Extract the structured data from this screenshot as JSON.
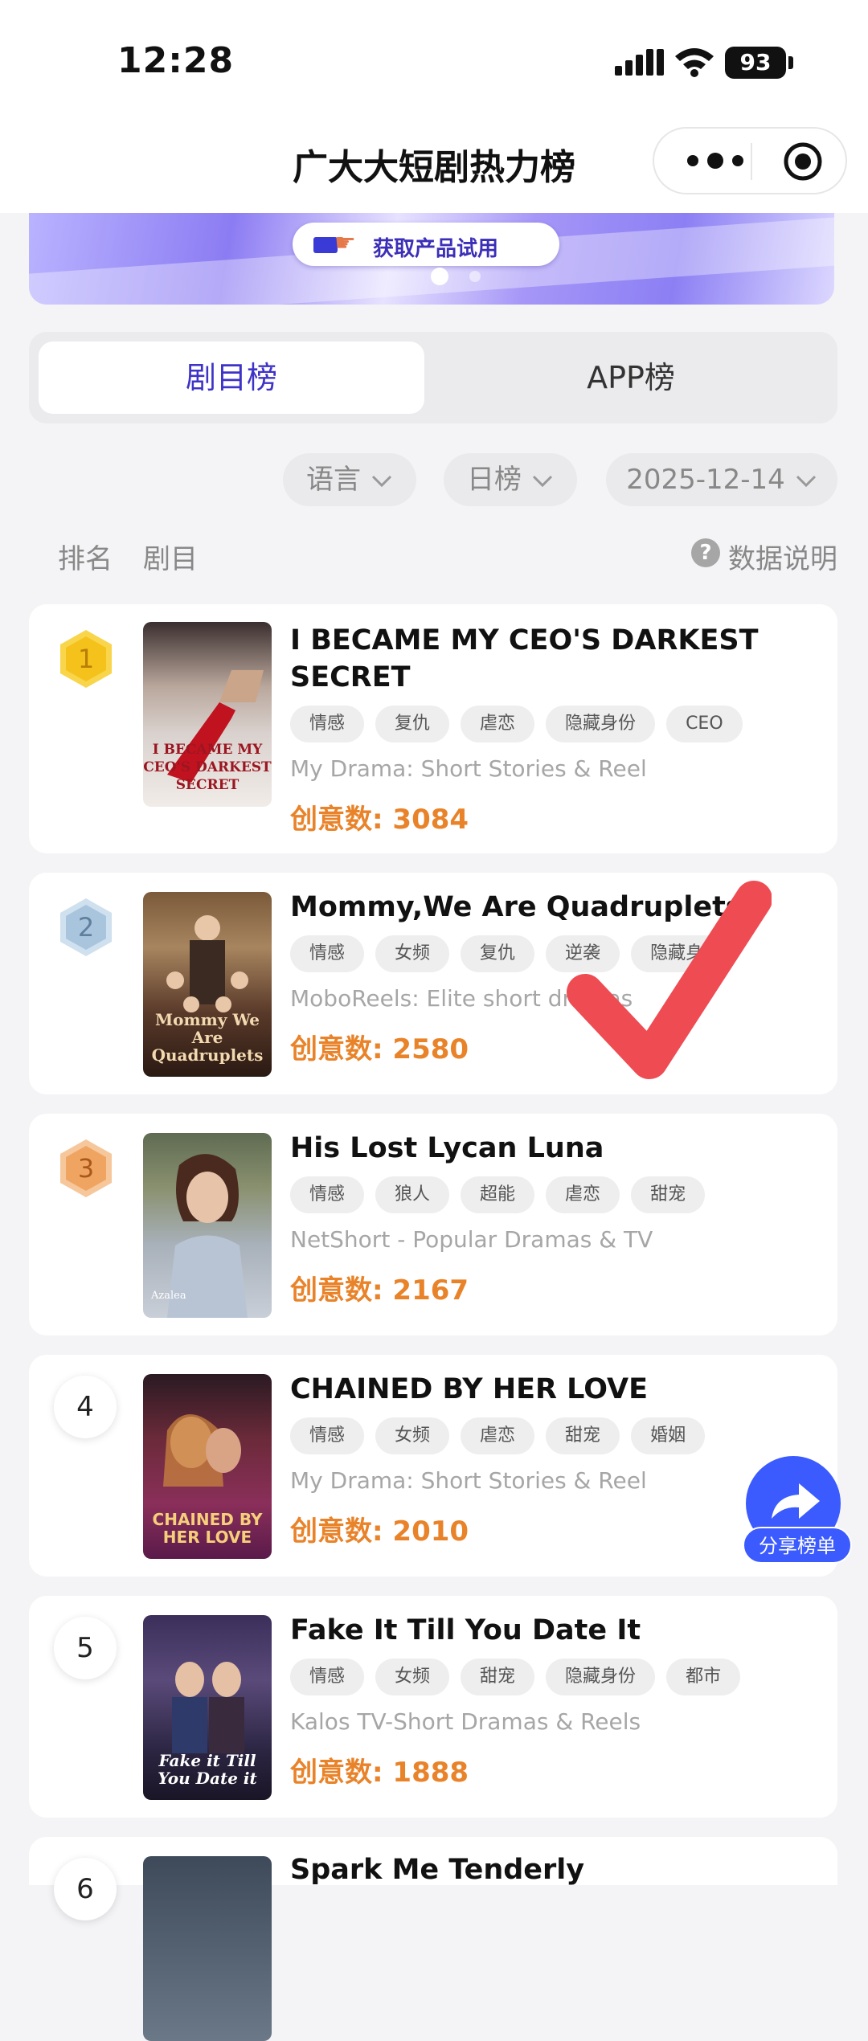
{
  "status_bar": {
    "time": "12:28",
    "battery": "93"
  },
  "nav": {
    "title": "广大大短剧热力榜"
  },
  "banner": {
    "button_label": "获取产品试用"
  },
  "tabs": [
    {
      "label": "剧目榜",
      "active": true
    },
    {
      "label": "APP榜",
      "active": false
    }
  ],
  "filters": {
    "language": "语言",
    "period": "日榜",
    "date": "2025-12-14"
  },
  "list_header": {
    "rank": "排名",
    "drama": "剧目",
    "data_note": "数据说明"
  },
  "share": {
    "label": "分享榜单"
  },
  "items": [
    {
      "rank": "1",
      "title": "I BECAME MY CEO'S DARKEST SECRET",
      "tags": [
        "情感",
        "复仇",
        "虐恋",
        "隐藏身份",
        "CEO"
      ],
      "app": "My Drama: Short Stories & Reel",
      "score": "创意数: 3084",
      "cover_text": "I BECAME MY CEO'S DARKEST SECRET"
    },
    {
      "rank": "2",
      "title": "Mommy,We Are Quadruplets",
      "tags": [
        "情感",
        "女频",
        "复仇",
        "逆袭",
        "隐藏身份"
      ],
      "app": "MoboReels: Elite short dramas",
      "score": "创意数: 2580",
      "cover_text": "Mommy We Are Quadruplets"
    },
    {
      "rank": "3",
      "title": "His Lost Lycan Luna",
      "tags": [
        "情感",
        "狼人",
        "超能",
        "虐恋",
        "甜宠"
      ],
      "app": "NetShort - Popular Dramas & TV",
      "score": "创意数: 2167",
      "cover_text": "Azalea"
    },
    {
      "rank": "4",
      "title": "CHAINED BY HER LOVE",
      "tags": [
        "情感",
        "女频",
        "虐恋",
        "甜宠",
        "婚姻"
      ],
      "app": "My Drama: Short Stories & Reel",
      "score": "创意数: 2010",
      "cover_text": "CHAINED BY HER LOVE"
    },
    {
      "rank": "5",
      "title": "Fake It Till You Date It",
      "tags": [
        "情感",
        "女频",
        "甜宠",
        "隐藏身份",
        "都市"
      ],
      "app": "Kalos TV-Short Dramas & Reels",
      "score": "创意数: 1888",
      "cover_text": "Fake it Till You Date it"
    },
    {
      "rank": "6",
      "title": "Spark Me Tenderly"
    }
  ],
  "colors": {
    "accent": "#3e33c7",
    "score": "#e9832a",
    "share": "#3b5bff",
    "gold": "#f5c21b",
    "silver": "#a9c4dd",
    "bronze": "#f0a461"
  },
  "icons": {
    "more": "more-dots-icon",
    "close": "target-circle-icon",
    "chevron": "chevron-down-icon",
    "share": "share-arrow-icon",
    "help": "question-circle-icon"
  }
}
